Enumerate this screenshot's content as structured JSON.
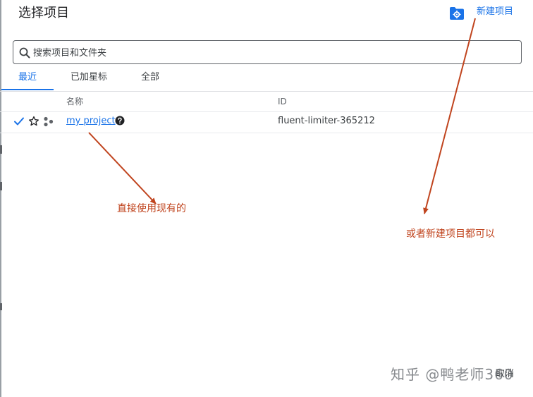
{
  "dialog": {
    "title": "选择项目",
    "new_project_label": "新建项目"
  },
  "search": {
    "placeholder": "搜索项目和文件夹",
    "value": ""
  },
  "tabs": [
    {
      "label": "最近",
      "active": true
    },
    {
      "label": "已加星标",
      "active": false
    },
    {
      "label": "全部",
      "active": false
    }
  ],
  "table": {
    "columns": [
      "名称",
      "ID"
    ],
    "rows": [
      {
        "selected": true,
        "starred": false,
        "name": "my project",
        "id": "fluent-limiter-365212"
      }
    ]
  },
  "annotations": [
    {
      "text": "直接使用现有的"
    },
    {
      "text": "或者新建项目都可以"
    }
  ],
  "footer": {
    "cancel_label": "取消"
  },
  "watermark": "知乎 @鸭老师360",
  "colors": {
    "accent": "#1a73e8",
    "annotation": "#c0441e",
    "text": "#202124",
    "muted": "#5f6368",
    "divider": "#dadce0"
  },
  "icons": {
    "new_project": "folder-gear-icon",
    "search": "search-icon",
    "selected": "check-icon",
    "star": "star-outline-icon",
    "project": "project-nodes-icon",
    "help": "help-circle-icon"
  }
}
